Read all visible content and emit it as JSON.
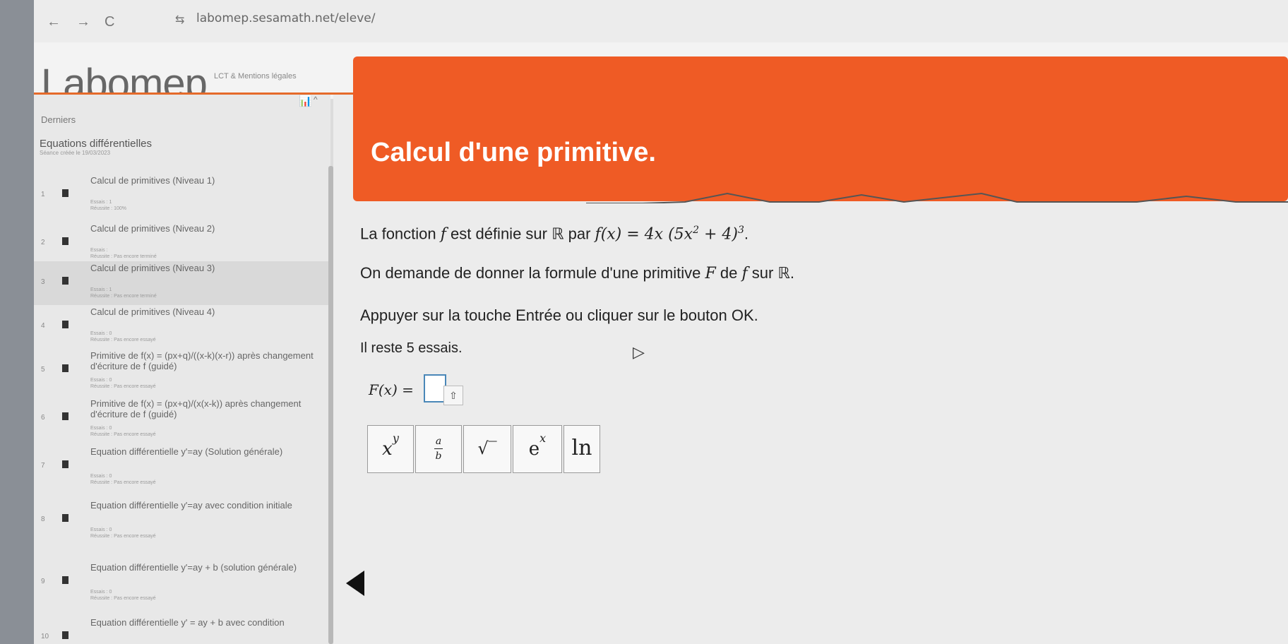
{
  "browser": {
    "url": "labomep.sesamath.net/eleve/",
    "back_icon": "←",
    "forward_icon": "→",
    "reload_icon": "C",
    "site_icon": "⇆"
  },
  "header": {
    "logo": "Labomep",
    "tagline": "LCT & Mentions légales"
  },
  "sidebar": {
    "head": "Derniers",
    "title": "Equations différentielles",
    "subtitle": "Séance créée le 19/03/2023",
    "items": [
      {
        "num": "1",
        "label": "Calcul de primitives (Niveau 1)",
        "meta": "Essais : 1\nRéussite : 100%"
      },
      {
        "num": "2",
        "label": "Calcul de primitives (Niveau 2)",
        "meta": "Essais :\nRéussite : Pas encore terminé"
      },
      {
        "num": "3",
        "label": "Calcul de primitives (Niveau 3)",
        "meta": "Essais : 1\nRéussite : Pas encore terminé"
      },
      {
        "num": "4",
        "label": "Calcul de primitives (Niveau 4)",
        "meta": "Essais : 0\nRéussite : Pas encore essayé"
      },
      {
        "num": "5",
        "label": "Primitive de f(x) = (px+q)/((x-k)(x-r)) après changement d'écriture de f (guidé)",
        "meta": "Essais : 0\nRéussite : Pas encore essayé"
      },
      {
        "num": "6",
        "label": "Primitive de f(x) = (px+q)/(x(x-k)) après changement d'écriture de f (guidé)",
        "meta": "Essais : 0\nRéussite : Pas encore essayé"
      },
      {
        "num": "7",
        "label": "Equation différentielle y'=ay (Solution générale)",
        "meta": "Essais : 0\nRéussite : Pas encore essayé"
      },
      {
        "num": "8",
        "label": "Equation différentielle y'=ay avec condition initiale",
        "meta": "Essais : 0\nRéussite : Pas encore essayé"
      },
      {
        "num": "9",
        "label": "Equation différentielle y'=ay + b (solution générale)",
        "meta": "Essais : 0\nRéussite : Pas encore essayé"
      },
      {
        "num": "10",
        "label": "Equation différentielle y' = ay + b avec condition",
        "meta": ""
      }
    ],
    "chart_icon": "📊",
    "caret_icon": "^"
  },
  "main": {
    "title": "Calcul d'une primitive.",
    "line1_prefix": "La fonction ",
    "line1_f": "f",
    "line1_mid": " est définie sur ℝ par ",
    "line1_formula_a": "f(x) = 4x (5x",
    "line1_exp2": "2",
    "line1_formula_b": " + 4)",
    "line1_exp3": "3",
    "line1_end": ".",
    "line2_prefix": "On demande de donner la formule d'une primitive ",
    "line2_F": "F",
    "line2_mid": " de ",
    "line2_f": "f",
    "line2_end": " sur ℝ.",
    "line3": "Appuyer sur la touche Entrée ou cliquer sur le bouton OK.",
    "line4": "Il reste 5 essais.",
    "answer_label": "F(x) =",
    "shift_icon": "⇧",
    "keyboard": {
      "power_base": "x",
      "power_exp": "y",
      "frac_num": "a",
      "frac_den": "b",
      "sqrt": "√‾",
      "exp_base": "e",
      "exp_exp": "x",
      "ln": "ln"
    }
  },
  "colors": {
    "accent": "#ef5b25",
    "input_border": "#4a87b8"
  }
}
